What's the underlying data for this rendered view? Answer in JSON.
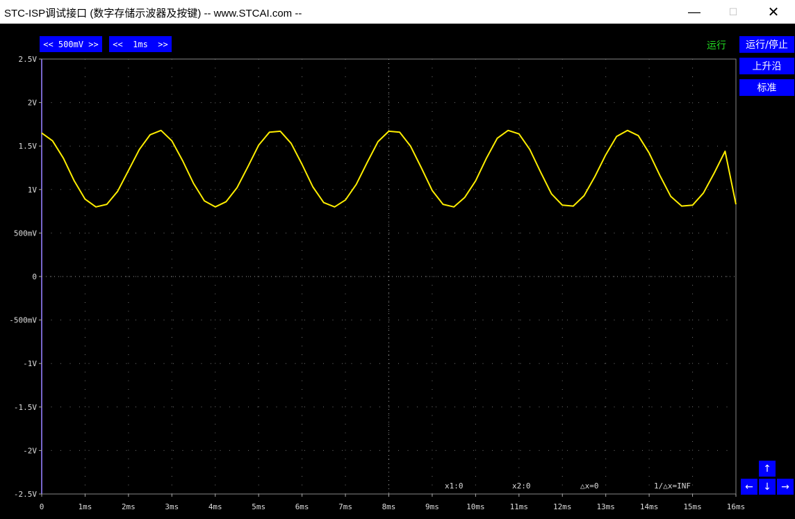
{
  "window": {
    "title": "STC-ISP调试接口 (数字存储示波器及按键) -- www.STCAI.com --",
    "min_glyph": "—",
    "max_glyph": "☐",
    "close_glyph": "✕"
  },
  "controls": {
    "volt_div": "<< 500mV >>",
    "time_div": "<<  1ms  >>",
    "status": "运行",
    "run_stop": "运行/停止",
    "edge": "上升沿",
    "mode": "标准"
  },
  "nav": {
    "up": "↑",
    "down": "↓",
    "left": "←",
    "right": "→"
  },
  "cursors": {
    "x1": "x1:0",
    "x2": "x2:0",
    "dx": "△x=0",
    "inv_dx": "1/△x=INF"
  },
  "colors": {
    "trace": "#ffee00",
    "button": "#0000ff",
    "status": "#22dd22",
    "background": "#000000"
  },
  "chart_data": {
    "type": "line",
    "title": "",
    "xlabel": "",
    "ylabel": "",
    "xlim": [
      0,
      16
    ],
    "ylim": [
      -2.5,
      2.5
    ],
    "grid": true,
    "y_ticks": [
      {
        "v": 2.5,
        "label": "2.5V"
      },
      {
        "v": 2,
        "label": "2V"
      },
      {
        "v": 1.5,
        "label": "1.5V"
      },
      {
        "v": 1,
        "label": "1V"
      },
      {
        "v": 0.5,
        "label": "500mV"
      },
      {
        "v": 0,
        "label": "0"
      },
      {
        "v": -0.5,
        "label": "-500mV"
      },
      {
        "v": -1,
        "label": "-1V"
      },
      {
        "v": -1.5,
        "label": "-1.5V"
      },
      {
        "v": -2,
        "label": "-2V"
      },
      {
        "v": -2.5,
        "label": "-2.5V"
      }
    ],
    "x_ticks": [
      {
        "v": 0,
        "label": "0"
      },
      {
        "v": 1,
        "label": "1ms"
      },
      {
        "v": 2,
        "label": "2ms"
      },
      {
        "v": 3,
        "label": "3ms"
      },
      {
        "v": 4,
        "label": "4ms"
      },
      {
        "v": 5,
        "label": "5ms"
      },
      {
        "v": 6,
        "label": "6ms"
      },
      {
        "v": 7,
        "label": "7ms"
      },
      {
        "v": 8,
        "label": "8ms"
      },
      {
        "v": 9,
        "label": "9ms"
      },
      {
        "v": 10,
        "label": "10ms"
      },
      {
        "v": 11,
        "label": "11ms"
      },
      {
        "v": 12,
        "label": "12ms"
      },
      {
        "v": 13,
        "label": "13ms"
      },
      {
        "v": 14,
        "label": "14ms"
      },
      {
        "v": 15,
        "label": "15ms"
      },
      {
        "v": 16,
        "label": "16ms"
      }
    ],
    "series": [
      {
        "x": [
          0,
          0.25,
          0.5,
          0.75,
          1.0,
          1.25,
          1.5,
          1.75,
          2.0,
          2.25,
          2.5,
          2.75,
          3.0,
          3.25,
          3.5,
          3.75,
          4.0,
          4.25,
          4.5,
          4.75,
          5.0,
          5.25,
          5.5,
          5.75,
          6.0,
          6.25,
          6.5,
          6.75,
          7.0,
          7.25,
          7.5,
          7.75,
          8.0,
          8.25,
          8.5,
          8.75,
          9.0,
          9.25,
          9.5,
          9.75,
          10.0,
          10.25,
          10.5,
          10.75,
          11.0,
          11.25,
          11.5,
          11.75,
          12.0,
          12.25,
          12.5,
          12.75,
          13.0,
          13.25,
          13.5,
          13.75,
          14.0,
          14.25,
          14.5,
          14.75,
          15.0,
          15.25,
          15.5,
          15.75,
          16.0
        ],
        "y": [
          1.65,
          1.56,
          1.36,
          1.1,
          0.89,
          0.8,
          0.83,
          0.98,
          1.22,
          1.46,
          1.63,
          1.68,
          1.56,
          1.33,
          1.07,
          0.87,
          0.8,
          0.86,
          1.02,
          1.26,
          1.51,
          1.66,
          1.67,
          1.53,
          1.29,
          1.03,
          0.85,
          0.8,
          0.88,
          1.06,
          1.31,
          1.55,
          1.67,
          1.66,
          1.5,
          1.25,
          0.99,
          0.83,
          0.8,
          0.91,
          1.1,
          1.36,
          1.59,
          1.68,
          1.64,
          1.46,
          1.2,
          0.95,
          0.82,
          0.81,
          0.93,
          1.15,
          1.4,
          1.61,
          1.68,
          1.62,
          1.42,
          1.16,
          0.92,
          0.81,
          0.82,
          0.96,
          1.19,
          1.44,
          0.83
        ]
      }
    ]
  }
}
